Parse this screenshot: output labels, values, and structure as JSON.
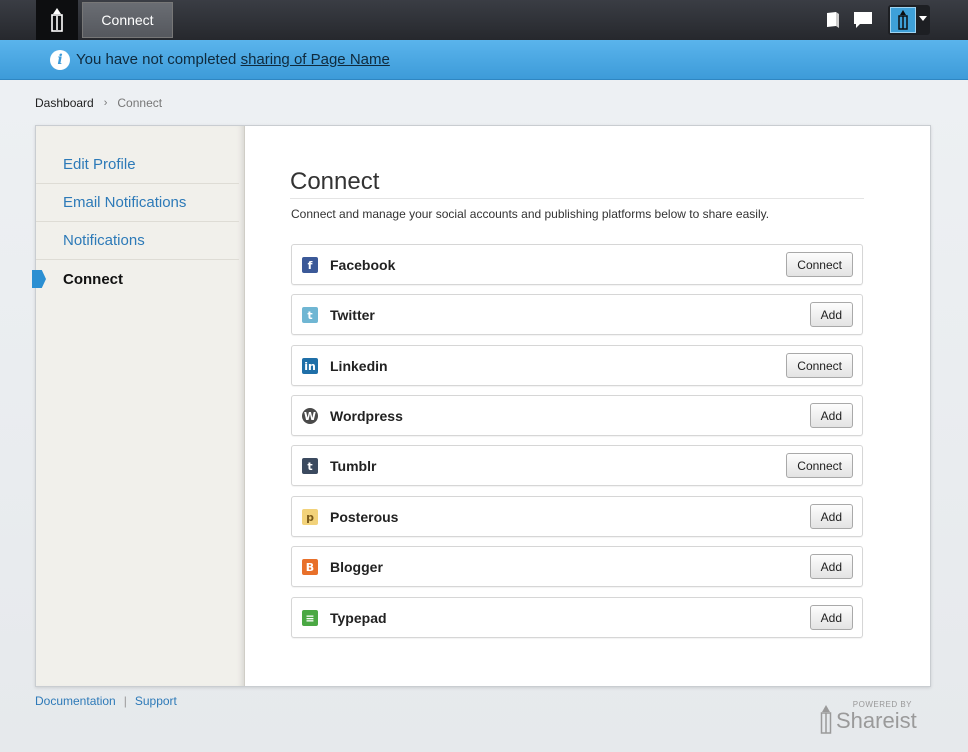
{
  "topbar": {
    "active_tab": "Connect",
    "icons": [
      "pencil-logo-icon",
      "book-icon",
      "chat-icon",
      "user-avatar-icon",
      "caret-down-icon"
    ]
  },
  "notice": {
    "text": "You have not completed ",
    "link": "sharing of Page Name"
  },
  "breadcrumb": {
    "home": "Dashboard",
    "separator": "›",
    "current": "Connect"
  },
  "sidebar": {
    "items": [
      {
        "label": "Edit Profile"
      },
      {
        "label": "Email Notifications"
      },
      {
        "label": "Notifications"
      },
      {
        "label": "Connect",
        "active": true
      }
    ]
  },
  "main": {
    "title": "Connect",
    "description": "Connect and manage your social accounts and publishing platforms below to share easily.",
    "services": [
      {
        "name": "Facebook",
        "button": "Connect",
        "icon": "facebook-icon",
        "color": "#3b5998",
        "glyph": "f"
      },
      {
        "name": "Twitter",
        "button": "Add",
        "icon": "twitter-icon",
        "color": "#6fb6d3",
        "glyph": "t"
      },
      {
        "name": "Linkedin",
        "button": "Connect",
        "icon": "linkedin-icon",
        "color": "#1f6fa8",
        "glyph": "in"
      },
      {
        "name": "Wordpress",
        "button": "Add",
        "icon": "wordpress-icon",
        "color": "#4a4a4a",
        "glyph": "W"
      },
      {
        "name": "Tumblr",
        "button": "Connect",
        "icon": "tumblr-icon",
        "color": "#3b4a5f",
        "glyph": "t"
      },
      {
        "name": "Posterous",
        "button": "Add",
        "icon": "posterous-icon",
        "color": "#f2d27a",
        "glyph": "p"
      },
      {
        "name": "Blogger",
        "button": "Add",
        "icon": "blogger-icon",
        "color": "#e8702a",
        "glyph": "B"
      },
      {
        "name": "Typepad",
        "button": "Add",
        "icon": "typepad-icon",
        "color": "#4aa843",
        "glyph": "≡"
      }
    ]
  },
  "footer": {
    "documentation": "Documentation",
    "separator": "|",
    "support": "Support",
    "powered_by": "POWERED BY",
    "brand": "Shareist"
  },
  "colors": {
    "accent": "#3d9bd9",
    "link": "#2d7ab8"
  }
}
